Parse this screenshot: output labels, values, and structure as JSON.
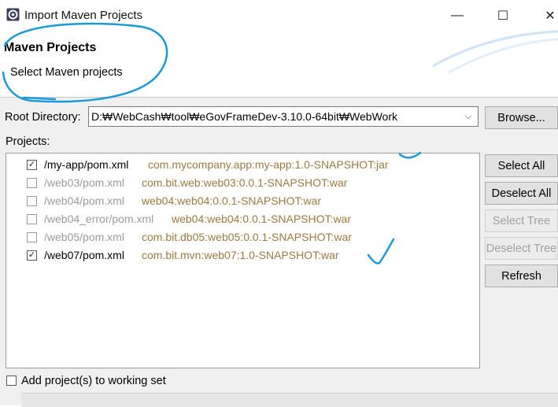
{
  "window": {
    "title": "Import Maven Projects",
    "minimize_glyph": "—",
    "maximize_glyph": "☐",
    "close_glyph": "✕"
  },
  "header": {
    "title": "Maven Projects",
    "description": "Select Maven projects"
  },
  "root_directory": {
    "label": "Root Directory:",
    "value": "D:₩WebCash₩tool₩eGovFrameDev-3.10.0-64bit₩WebWork",
    "dropdown_glyph": "⌵",
    "browse_label": "Browse..."
  },
  "projects": {
    "label": "Projects:",
    "items": [
      {
        "checked": true,
        "enabled": true,
        "path": "/my-app/pom.xml",
        "artifact": "com.mycompany.app:my-app:1.0-SNAPSHOT:jar"
      },
      {
        "checked": false,
        "enabled": false,
        "path": "/web03/pom.xml",
        "artifact": "com.bit.web:web03:0.0.1-SNAPSHOT:war"
      },
      {
        "checked": false,
        "enabled": false,
        "path": "/web04/pom.xml",
        "artifact": "web04:web04:0.0.1-SNAPSHOT:war"
      },
      {
        "checked": false,
        "enabled": false,
        "path": "/web04_error/pom.xml",
        "artifact": "web04:web04:0.0.1-SNAPSHOT:war"
      },
      {
        "checked": false,
        "enabled": false,
        "path": "/web05/pom.xml",
        "artifact": "com.bit.db05:web05:0.0.1-SNAPSHOT:war"
      },
      {
        "checked": true,
        "enabled": true,
        "path": "/web07/pom.xml",
        "artifact": "com.bit.mvn:web07:1.0-SNAPSHOT:war"
      }
    ]
  },
  "buttons": {
    "select_all": "Select All",
    "deselect_all": "Deselect All",
    "select_tree": "Select Tree",
    "deselect_tree": "Deselect Tree",
    "refresh": "Refresh"
  },
  "working_set": {
    "label": "Add project(s) to working set",
    "checked": false
  },
  "colors": {
    "annotation": "#1a9ad6",
    "artifact_text": "#9c7a3e",
    "disabled_text": "#9a9a9a"
  },
  "icons": {
    "app": "eclipse-gear-icon",
    "checkmark": "✓"
  }
}
